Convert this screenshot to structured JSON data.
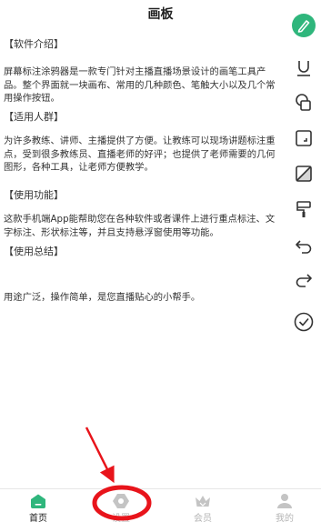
{
  "page": {
    "title": "画板"
  },
  "sections": [
    {
      "heading": "【软件介绍】",
      "body": "屏幕标注涂鸦器是一款专门针对主播直播场景设计的画笔工具产品。整个界面就一块画布、常用的几种颜色、笔触大小以及几个常用操作按钮。"
    },
    {
      "heading": "【适用人群】",
      "body": "为许多教练、讲师、主播提供了方便。让教练可以现场讲题标注重点，受到很多教练员、直播老师的好评；也提供了老师需要的几何图形，各种工具，让老师方便教学。"
    },
    {
      "heading": "【使用功能】",
      "body": "这款手机端App能帮助您在各种软件或者课件上进行重点标注、文字标注、形状标注等，并且支持悬浮窗使用等功能。"
    },
    {
      "heading": "【使用总结】",
      "body": "用途广泛，操作简单，是您直播贴心的小帮手。"
    }
  ],
  "toolbar": {
    "accent": "#2fb67c",
    "tools": [
      "pen-icon",
      "underline-icon",
      "shapes-icon",
      "crop-square-icon",
      "eraser-square-icon",
      "paint-roller-icon",
      "undo-icon",
      "redo-icon",
      "check-circle-icon"
    ]
  },
  "bottom_nav": {
    "active_color": "#2fb67c",
    "items": [
      {
        "label": "首页",
        "icon": "home-icon"
      },
      {
        "label": "设置",
        "icon": "settings-icon"
      },
      {
        "label": "会员",
        "icon": "crown-icon"
      },
      {
        "label": "我的",
        "icon": "user-icon"
      }
    ]
  },
  "annotation": {
    "color": "#e8141b"
  }
}
